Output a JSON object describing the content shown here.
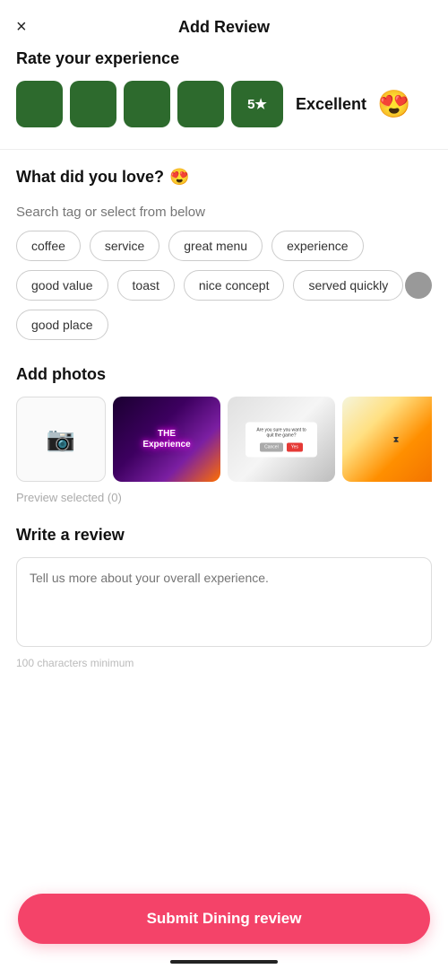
{
  "header": {
    "close_label": "×",
    "title": "Add Review"
  },
  "rate_section": {
    "label": "Rate your experience",
    "stars": [
      {
        "filled": true,
        "label": ""
      },
      {
        "filled": true,
        "label": ""
      },
      {
        "filled": true,
        "label": ""
      },
      {
        "filled": true,
        "label": ""
      },
      {
        "filled": true,
        "label": "5★"
      }
    ],
    "rating_label": "Excellent",
    "rating_emoji": "😍"
  },
  "love_section": {
    "label": "What did you love?",
    "label_emoji": "😍",
    "search_placeholder": "Search tag or select from below",
    "tags": [
      "coffee",
      "service",
      "great menu",
      "experience",
      "good value",
      "toast",
      "nice concept",
      "served quickly",
      "good place"
    ]
  },
  "photos_section": {
    "label": "Add photos",
    "photos": [
      {
        "type": "add",
        "label": ""
      },
      {
        "type": "neon",
        "label": "THE Experience"
      },
      {
        "type": "dialog",
        "label": ""
      },
      {
        "type": "warm",
        "label": ""
      }
    ],
    "preview_label": "Preview selected (0)"
  },
  "review_section": {
    "label": "Write a review",
    "placeholder": "Tell us more about your overall experience."
  },
  "submit_button": {
    "label": "Submit Dining review"
  }
}
